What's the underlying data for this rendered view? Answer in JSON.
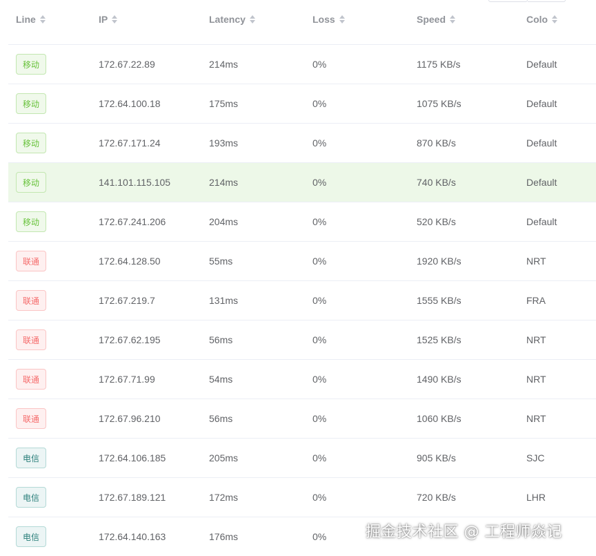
{
  "columns": {
    "line": "Line",
    "ip": "IP",
    "latency": "Latency",
    "loss": "Loss",
    "speed": "Speed",
    "colo": "Colo"
  },
  "rows": [
    {
      "line": "移动",
      "line_type": "green",
      "ip": "172.67.22.89",
      "latency": "214ms",
      "loss": "0%",
      "speed": "1175 KB/s",
      "colo": "Default"
    },
    {
      "line": "移动",
      "line_type": "green",
      "ip": "172.64.100.18",
      "latency": "175ms",
      "loss": "0%",
      "speed": "1075 KB/s",
      "colo": "Default"
    },
    {
      "line": "移动",
      "line_type": "green",
      "ip": "172.67.171.24",
      "latency": "193ms",
      "loss": "0%",
      "speed": "870 KB/s",
      "colo": "Default"
    },
    {
      "line": "移动",
      "line_type": "green",
      "ip": "141.101.115.105",
      "latency": "214ms",
      "loss": "0%",
      "speed": "740 KB/s",
      "colo": "Default"
    },
    {
      "line": "移动",
      "line_type": "green",
      "ip": "172.67.241.206",
      "latency": "204ms",
      "loss": "0%",
      "speed": "520 KB/s",
      "colo": "Default"
    },
    {
      "line": "联通",
      "line_type": "red",
      "ip": "172.64.128.50",
      "latency": "55ms",
      "loss": "0%",
      "speed": "1920 KB/s",
      "colo": "NRT"
    },
    {
      "line": "联通",
      "line_type": "red",
      "ip": "172.67.219.7",
      "latency": "131ms",
      "loss": "0%",
      "speed": "1555 KB/s",
      "colo": "FRA"
    },
    {
      "line": "联通",
      "line_type": "red",
      "ip": "172.67.62.195",
      "latency": "56ms",
      "loss": "0%",
      "speed": "1525 KB/s",
      "colo": "NRT"
    },
    {
      "line": "联通",
      "line_type": "red",
      "ip": "172.67.71.99",
      "latency": "54ms",
      "loss": "0%",
      "speed": "1490 KB/s",
      "colo": "NRT"
    },
    {
      "line": "联通",
      "line_type": "red",
      "ip": "172.67.96.210",
      "latency": "56ms",
      "loss": "0%",
      "speed": "1060 KB/s",
      "colo": "NRT"
    },
    {
      "line": "电信",
      "line_type": "teal",
      "ip": "172.64.106.185",
      "latency": "205ms",
      "loss": "0%",
      "speed": "905 KB/s",
      "colo": "SJC"
    },
    {
      "line": "电信",
      "line_type": "teal",
      "ip": "172.67.189.121",
      "latency": "172ms",
      "loss": "0%",
      "speed": "720 KB/s",
      "colo": "LHR"
    },
    {
      "line": "电信",
      "line_type": "teal",
      "ip": "172.64.140.163",
      "latency": "176ms",
      "loss": "0%",
      "speed": "",
      "colo": ""
    }
  ],
  "highlighted_row_index": 3,
  "colors": {
    "green_tag": "#67c23a",
    "red_tag": "#f56c6c",
    "teal_tag": "#2a7f7a",
    "highlight_row": "#edf8e8"
  },
  "watermark": "掘金技术社区 @ 工程师焱记"
}
